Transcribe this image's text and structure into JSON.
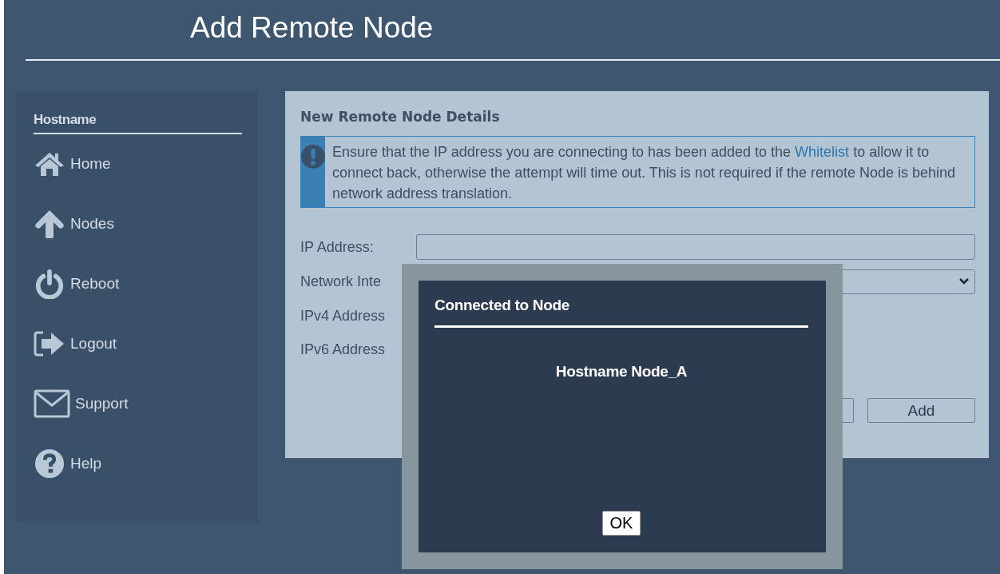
{
  "page": {
    "title": "Add Remote Node"
  },
  "sidebar": {
    "header": "Hostname",
    "items": [
      {
        "kind": "home",
        "label": "Home"
      },
      {
        "kind": "nodes",
        "label": "Nodes"
      },
      {
        "kind": "reboot",
        "label": "Reboot"
      },
      {
        "kind": "logout",
        "label": "Logout"
      },
      {
        "kind": "support",
        "label": "Support"
      },
      {
        "kind": "help",
        "label": "Help"
      }
    ]
  },
  "panel": {
    "title": "New Remote Node Details",
    "alert": {
      "before": "Ensure that the IP address you are connecting to has been added to the",
      "link": "Whitelist",
      "after": "to allow it to connect back, otherwise the attempt will time out. This is not required if the remote Node is behind network address translation."
    },
    "fields": [
      {
        "kind": "input",
        "label": "IP Address:"
      },
      {
        "kind": "select",
        "label": "Network Inte"
      },
      {
        "kind": "text",
        "label": "IPv4 Address"
      },
      {
        "kind": "text",
        "label": "IPv6 Address"
      }
    ],
    "buttons": [
      {
        "kind": "blank"
      },
      {
        "kind": "labelled",
        "label": "Add"
      }
    ]
  },
  "dialog": {
    "title": "Connected to Node",
    "message": "Hostname Node_A",
    "button": "OK"
  }
}
